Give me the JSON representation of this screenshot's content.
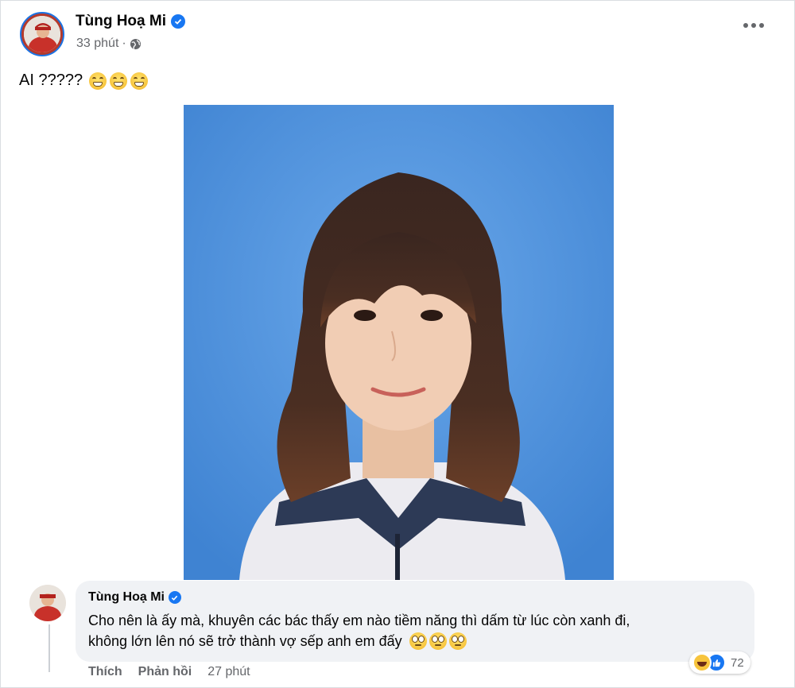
{
  "post": {
    "author": "Tùng Hoạ Mi",
    "time": "33 phút",
    "separator": "·",
    "text": "AI ?????",
    "emoji_count": 3
  },
  "comment": {
    "author": "Tùng Hoạ Mi",
    "line1": "Cho nên là ấy mà, khuyên các bác thấy em nào tiềm năng thì dấm từ lúc còn xanh đi,",
    "line2": "không lớn lên nó sẽ trở thành vợ sếp anh em đấy",
    "like_label": "Thích",
    "reply_label": "Phản hồi",
    "time": "27 phút",
    "reaction_count": "72"
  },
  "icons": {
    "verified": "verified-badge-icon",
    "privacy": "globe-icon",
    "more": "more-options-icon",
    "reactions": [
      "haha-icon",
      "like-icon"
    ]
  },
  "colors": {
    "accent": "#1877f2",
    "photo_background": "#4d8fd8",
    "comment_bubble": "#f0f2f5",
    "secondary_text": "#65676b"
  }
}
